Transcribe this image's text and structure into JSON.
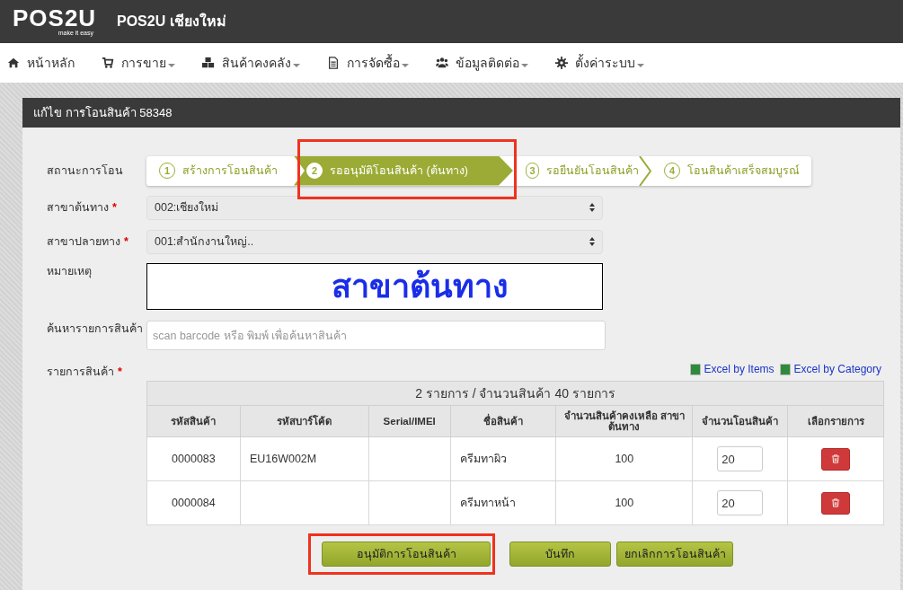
{
  "app": {
    "logo_text": "POS2U",
    "logo_tagline": "make it easy",
    "title": "POS2U เชียงใหม่"
  },
  "nav": [
    {
      "label": "หน้าหลัก",
      "dropdown": false
    },
    {
      "label": "การขาย",
      "dropdown": true
    },
    {
      "label": "สินค้าคงคลัง",
      "dropdown": true
    },
    {
      "label": "การจัดซื้อ",
      "dropdown": true
    },
    {
      "label": "ข้อมูลติดต่อ",
      "dropdown": true
    },
    {
      "label": "ตั้งค่าระบบ",
      "dropdown": true
    }
  ],
  "panel": {
    "title": "แก้ไข การโอนสินค้า 58348"
  },
  "status": {
    "label": "สถานะการโอน",
    "steps": [
      {
        "number": "1",
        "label": "สร้างการโอนสินค้า",
        "selected": false,
        "highlighted": false
      },
      {
        "number": "2",
        "label": "รออนุมัติโอนสินค้า (ต้นทาง)",
        "selected": true,
        "highlighted": true
      },
      {
        "number": "3",
        "label": "รอยืนยันโอนสินค้า",
        "selected": false,
        "highlighted": false
      },
      {
        "number": "4",
        "label": "โอนสินค้าเสร็จสมบูรณ์",
        "selected": false,
        "highlighted": false
      }
    ]
  },
  "source_branch": {
    "label": "สาขาต้นทาง",
    "required_mark": "*",
    "value": "002:เชียงใหม่"
  },
  "dest_branch": {
    "label": "สาขาปลายทาง",
    "required_mark": "*",
    "value": "001:สำนักงานใหญ่.."
  },
  "remark": {
    "label": "หมายเหตุ",
    "value": "สาขาต้นทาง"
  },
  "search": {
    "label": "ค้นหารายการสินค้า",
    "placeholder": "scan barcode หรือ พิมพ์ เพื่อค้นหาสินค้า"
  },
  "items": {
    "label": "รายการสินค้า",
    "required_mark": "*",
    "export_links": [
      "Excel by Items",
      "Excel by Category"
    ],
    "summary": "2 รายการ / จำนวนสินค้า 40 รายการ",
    "columns": [
      "รหัสสินค้า",
      "รหัสบาร์โค้ด",
      "Serial/IMEI",
      "ชื่อสินค้า",
      "จำนวนสินค้าคงเหลือ สาขาต้นทาง",
      "จำนวนโอนสินค้า",
      "เลือกรายการ"
    ],
    "rows": [
      {
        "code": "0000083",
        "barcode": "EU16W002M",
        "name": "ครีมทาผิว",
        "stock": "100",
        "quantity": "20"
      },
      {
        "code": "0000084",
        "name": "ครีมทาหน้า",
        "stock": "100",
        "quantity": "20"
      }
    ]
  },
  "buttons": [
    {
      "label": "อนุมัติการโอนสินค้า",
      "highlighted": true
    },
    {
      "label": "บันทึก",
      "highlighted": false
    },
    {
      "label": "ยกเลิกการโอนสินค้า",
      "highlighted": false
    }
  ]
}
